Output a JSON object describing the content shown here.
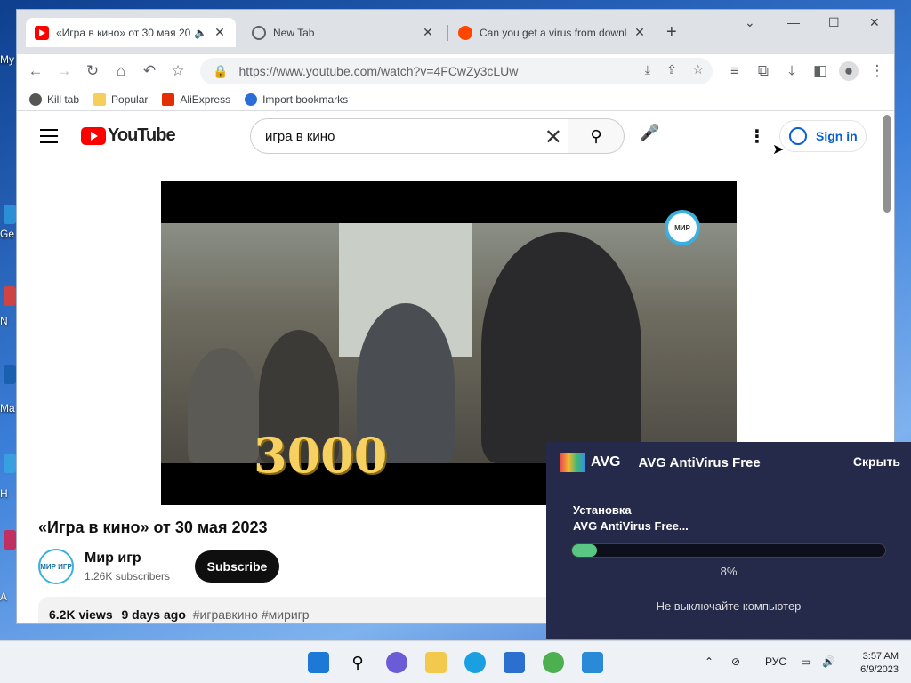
{
  "desktop": {
    "labels": [
      "My",
      "Ge",
      "N",
      "Ma",
      "H",
      "A"
    ]
  },
  "browser": {
    "tabs": [
      {
        "title": "«Игра в кино» от 30 мая 20",
        "active": true,
        "favicon": "youtube-icon"
      },
      {
        "title": "New Tab",
        "active": false,
        "favicon": "globe-icon"
      },
      {
        "title": "Can you get a virus from downlo",
        "active": false,
        "favicon": "reddit-icon"
      }
    ],
    "url": "https://www.youtube.com/watch?v=4FCwZy3cLUw",
    "bookmarks": [
      "Kill tab",
      "Popular",
      "AliExpress",
      "Import bookmarks"
    ]
  },
  "youtube": {
    "logo_text": "YouTube",
    "search_query": "игра в кино",
    "sign_in": "Sign in",
    "video_overlay_number": "3000",
    "channel_logo_text": "МИР",
    "video_title": "«Игра в кино» от 30 мая 2023",
    "channel_name": "Мир игр",
    "channel_avatar_text": "МИР ИГР",
    "subscribers": "1.26K subscribers",
    "subscribe": "Subscribe",
    "views": "6.2K views",
    "age": "9 days ago",
    "tags": "#игравкино #миригр"
  },
  "avg": {
    "brand": "AVG",
    "product": "AVG AntiVirus Free",
    "hide": "Скрыть",
    "line1": "Установка",
    "line2": "AVG AntiVirus Free...",
    "progress_percent": 8,
    "progress_label": "8%",
    "note": "Не выключайте компьютер"
  },
  "taskbar": {
    "language": "РУС",
    "time": "3:57 AM",
    "date": "6/9/2023"
  }
}
